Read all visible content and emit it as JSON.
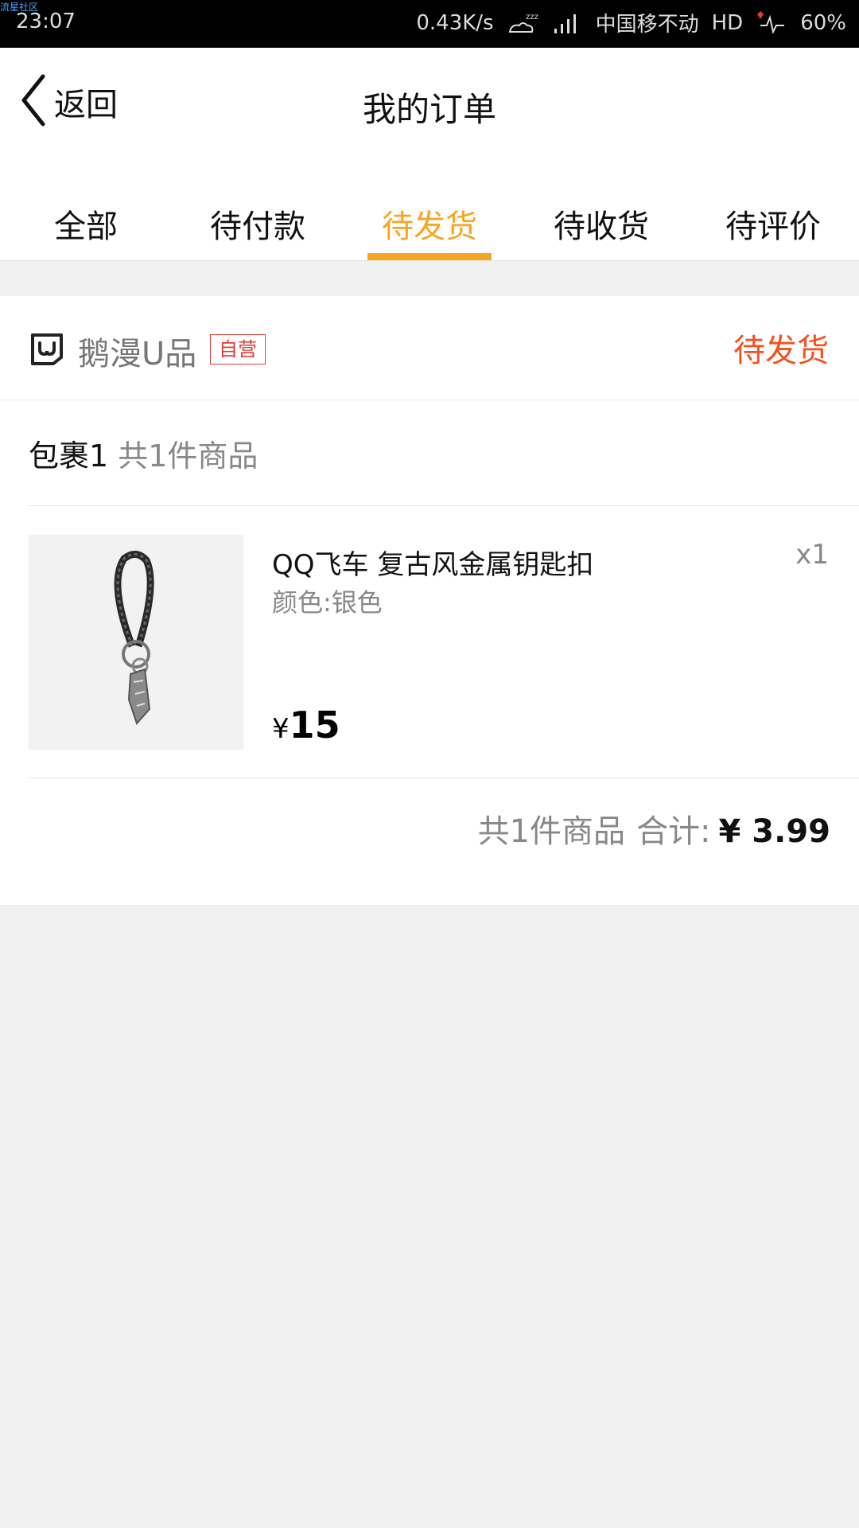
{
  "status_bar": {
    "watermark": "流星社区",
    "time": "23:07",
    "net_speed": "0.43K/s",
    "carrier": "中国移不动",
    "hd": "HD",
    "battery": "60%"
  },
  "header": {
    "back_label": "返回",
    "title": "我的订单"
  },
  "tabs": [
    {
      "label": "全部",
      "active": false
    },
    {
      "label": "待付款",
      "active": false
    },
    {
      "label": "待发货",
      "active": true
    },
    {
      "label": "待收货",
      "active": false
    },
    {
      "label": "待评价",
      "active": false
    }
  ],
  "order": {
    "shop_name": "鹅漫U品",
    "shop_badge": "自营",
    "status": "待发货",
    "package_label": "包裹1",
    "package_count": "共1件商品",
    "item": {
      "title": "QQ飞车 复古风金属钥匙扣",
      "variant": "颜色:银色",
      "quantity": "x1",
      "price_symbol": "¥",
      "price": "15"
    },
    "summary": {
      "count": "共1件商品",
      "label": "合计:",
      "amount": "¥ 3.99"
    }
  },
  "colors": {
    "accent": "#f5a623",
    "status": "#f4511e",
    "badge": "#e53935"
  }
}
